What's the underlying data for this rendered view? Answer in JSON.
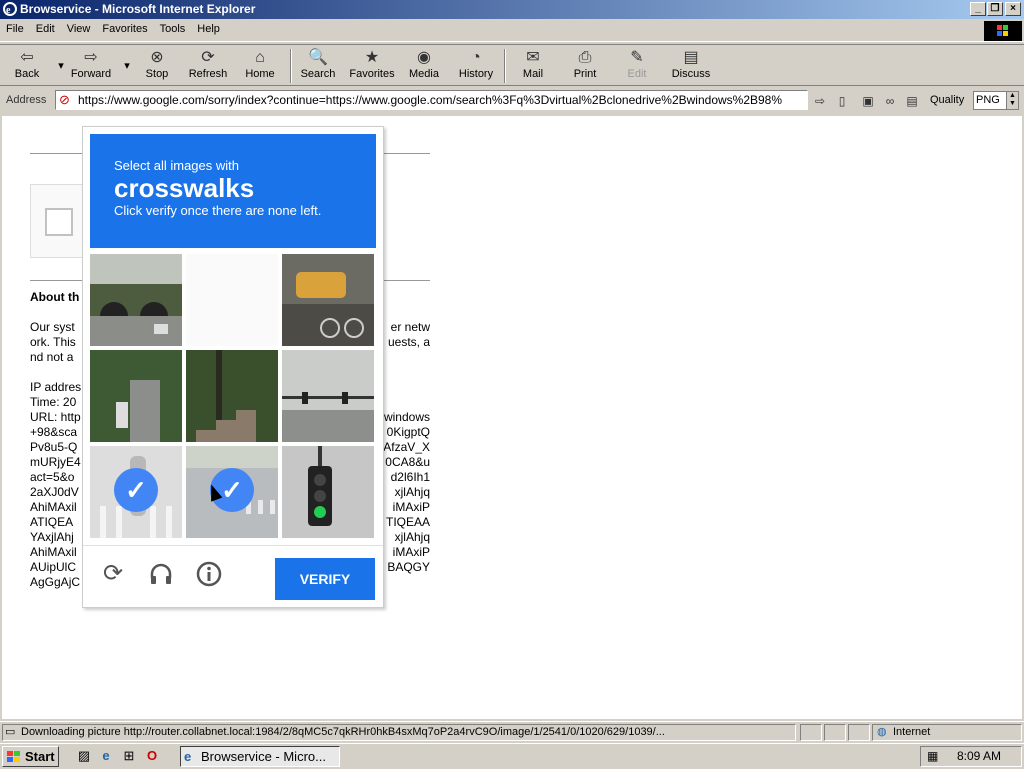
{
  "window": {
    "title": "Browservice - Microsoft Internet Explorer"
  },
  "menu": [
    "File",
    "Edit",
    "View",
    "Favorites",
    "Tools",
    "Help"
  ],
  "toolbar": [
    {
      "label": "Back",
      "icon": "back-arrow-icon",
      "glyph": "⇦"
    },
    {
      "label": "Forward",
      "icon": "forward-arrow-icon",
      "glyph": "⇨"
    },
    {
      "label": "Stop",
      "icon": "stop-icon",
      "glyph": "⊗"
    },
    {
      "label": "Refresh",
      "icon": "refresh-icon",
      "glyph": "⟳"
    },
    {
      "label": "Home",
      "icon": "home-icon",
      "glyph": "⌂"
    },
    {
      "label": "Search",
      "icon": "search-icon",
      "glyph": "🔍"
    },
    {
      "label": "Favorites",
      "icon": "favorites-icon",
      "glyph": "★"
    },
    {
      "label": "Media",
      "icon": "media-icon",
      "glyph": "◉"
    },
    {
      "label": "History",
      "icon": "history-icon",
      "glyph": "◔"
    },
    {
      "label": "Mail",
      "icon": "mail-icon",
      "glyph": "✉"
    },
    {
      "label": "Print",
      "icon": "print-icon",
      "glyph": "⎙"
    },
    {
      "label": "Edit",
      "icon": "edit-icon",
      "glyph": "✎",
      "disabled": true
    },
    {
      "label": "Discuss",
      "icon": "discuss-icon",
      "glyph": "▤"
    }
  ],
  "address": {
    "label": "Address",
    "url": "https://www.google.com/sorry/index?continue=https://www.google.com/search%3Fq%3Dvirtual%2Bclonedrive%2Bwindows%2B98%"
  },
  "quality": {
    "label": "Quality",
    "value": "PNG"
  },
  "background_page": {
    "title": "About th",
    "para": [
      {
        "left": "Our syst",
        "right": "er netw"
      },
      {
        "left": "ork. This",
        "right": "uests, a"
      },
      {
        "left": "nd not a",
        "right": ""
      }
    ],
    "ip_lines": [
      {
        "left": "IP addres",
        "right": ""
      },
      {
        "left": "Time: 20",
        "right": ""
      },
      {
        "left": "URL: http",
        "right": "windows"
      },
      {
        "left": "+98&sca",
        "right": "0KigptQ"
      },
      {
        "left": "Pv8u5-Q",
        "right": "AfzaV_X"
      },
      {
        "left": "mURjyE4",
        "right": "0CA8&u"
      },
      {
        "left": "act=5&o",
        "right": "d2l6Ih1"
      },
      {
        "left": "2aXJ0dV",
        "right": "xjlAhjq"
      },
      {
        "left": "AhiMAxil",
        "right": "iMAxiP"
      },
      {
        "left": "ATIQEA",
        "right": "TIQEAA"
      },
      {
        "left": "YAxjlAhj",
        "right": "xjlAhjq"
      },
      {
        "left": "AhiMAxil",
        "right": "iMAxiP"
      },
      {
        "left": "AUipUlC",
        "right": "BAQGY"
      },
      {
        "left": "AgGgAjC",
        "right": ""
      }
    ]
  },
  "captcha": {
    "instruction": "Select all images with",
    "target": "crosswalks",
    "hint": "Click verify once there are none left.",
    "verify_label": "VERIFY",
    "tiles": [
      {
        "scene": "bridge-tunnel",
        "selected": false
      },
      {
        "scene": "blank-loading",
        "selected": false
      },
      {
        "scene": "parked-cars-bicycle",
        "selected": false
      },
      {
        "scene": "street-trees-motorbike",
        "selected": false
      },
      {
        "scene": "stairs-trees",
        "selected": false
      },
      {
        "scene": "traffic-lights-road",
        "selected": false
      },
      {
        "scene": "crosswalk-pedestrian",
        "selected": true
      },
      {
        "scene": "crosswalk-road",
        "selected": true
      },
      {
        "scene": "traffic-light-green",
        "selected": false
      }
    ]
  },
  "status": {
    "text": "Downloading picture http://router.collabnet.local:1984/2/8qMC5c7qkRHr0hkB4sxMq7oP2a4rvC9O/image/1/2541/0/1020/629/1039/...",
    "zone": "Internet"
  },
  "taskbar": {
    "start": "Start",
    "task": "Browservice - Micro...",
    "clock": "8:09 AM"
  }
}
